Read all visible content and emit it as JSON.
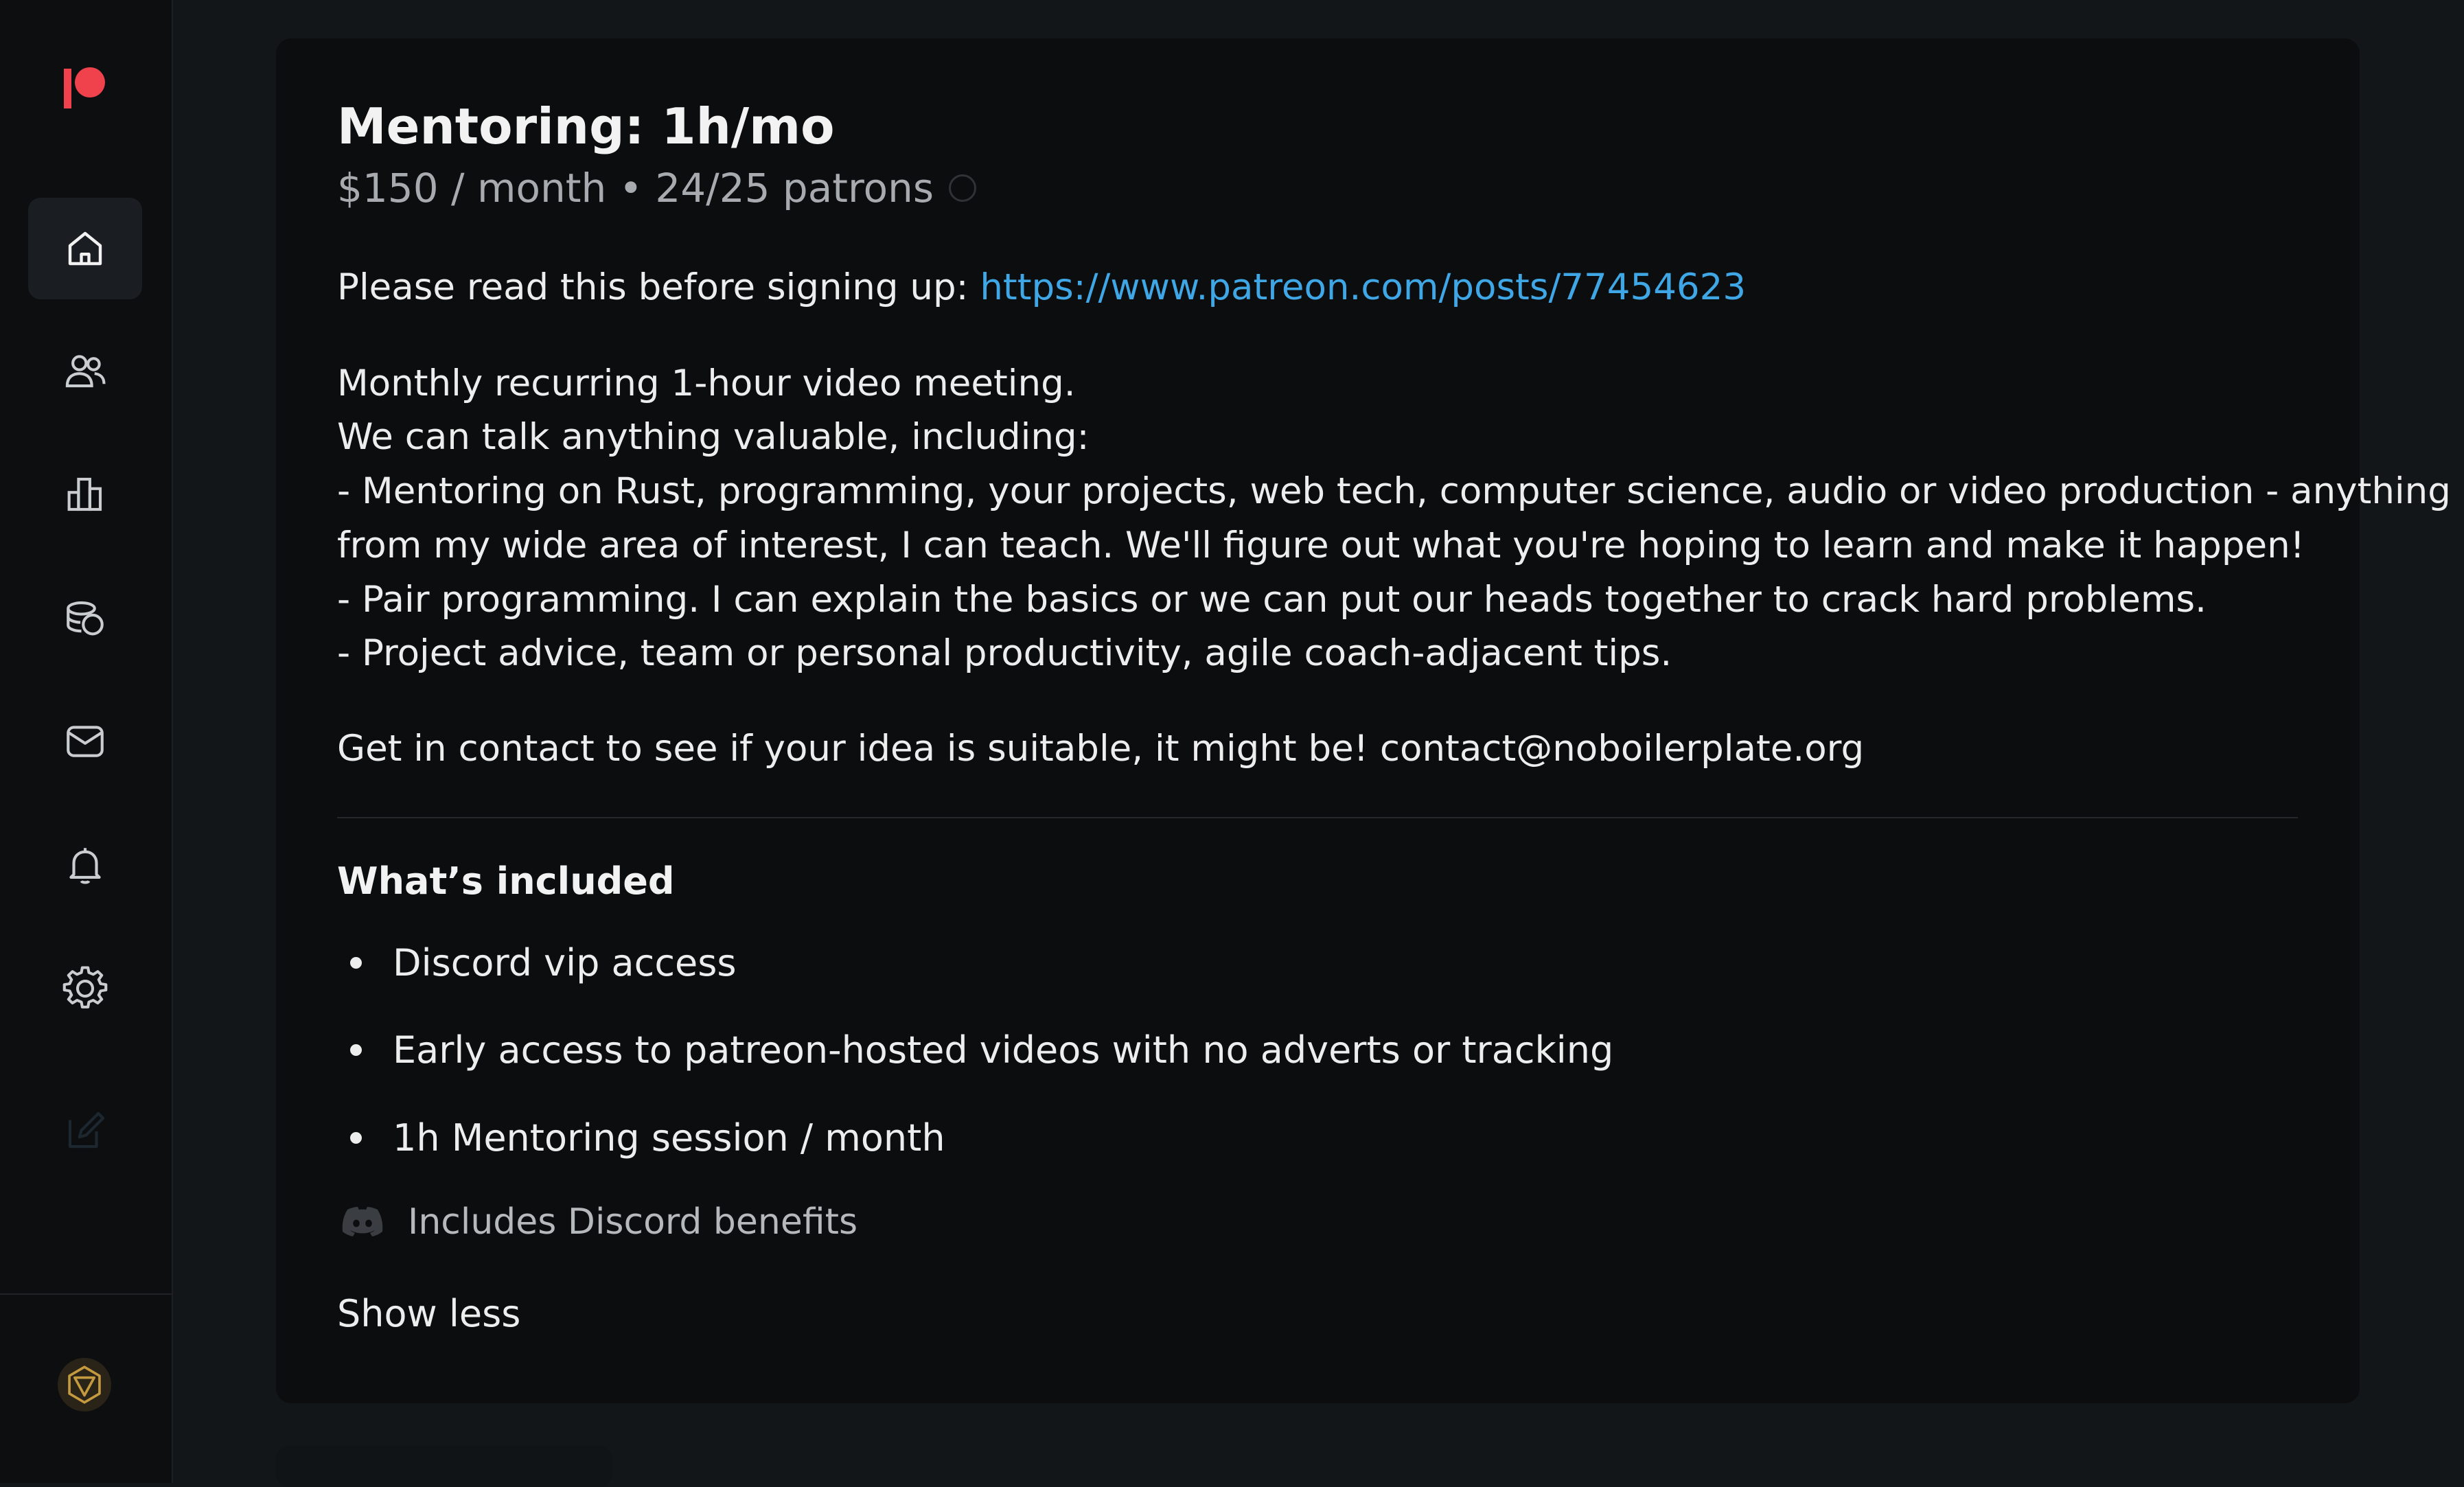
{
  "app": {
    "name": "Patreon",
    "brand_color": "#f0424d"
  },
  "sidebar": {
    "items": [
      {
        "name": "home",
        "icon": "home-icon",
        "active": true
      },
      {
        "name": "members",
        "icon": "people-icon",
        "active": false
      },
      {
        "name": "insights",
        "icon": "bar-chart-icon",
        "active": false
      },
      {
        "name": "payouts",
        "icon": "coins-icon",
        "active": false
      },
      {
        "name": "messages",
        "icon": "mail-icon",
        "active": false
      },
      {
        "name": "notifications",
        "icon": "bell-icon",
        "active": false
      },
      {
        "name": "settings",
        "icon": "gear-icon",
        "active": false
      },
      {
        "name": "create",
        "icon": "edit-icon",
        "active": false
      }
    ],
    "avatar_icon": "creator-avatar-icon"
  },
  "tier": {
    "title": "Mentoring: 1h/mo",
    "subtitle": "$150 / month • 24/25 patrons",
    "intro_prefix": "Please read this before signing up: ",
    "intro_link": "https://www.patreon.com/posts/77454623",
    "link_color": "#3fa7e6",
    "description": [
      "Monthly recurring 1-hour video meeting.",
      "We can talk anything valuable, including:",
      "- Mentoring on Rust, programming, your projects, web tech, computer science, audio or video production - anything",
      "from my wide area of interest, I can teach. We'll figure out what you're hoping to learn and make it happen!",
      "- Pair programming. I can explain the basics or we can put our heads together to crack hard problems.",
      "- Project advice, team or personal productivity, agile coach-adjacent tips."
    ],
    "contact": "Get in contact to see if your idea is suitable, it might be! contact@noboilerplate.org",
    "included_heading": "What’s included",
    "included_items": [
      "Discord vip access",
      "Early access to patreon-hosted videos with no adverts or tracking",
      "1h Mentoring session / month"
    ],
    "discord_benefits": "Includes Discord benefits",
    "show_less": "Show less"
  }
}
